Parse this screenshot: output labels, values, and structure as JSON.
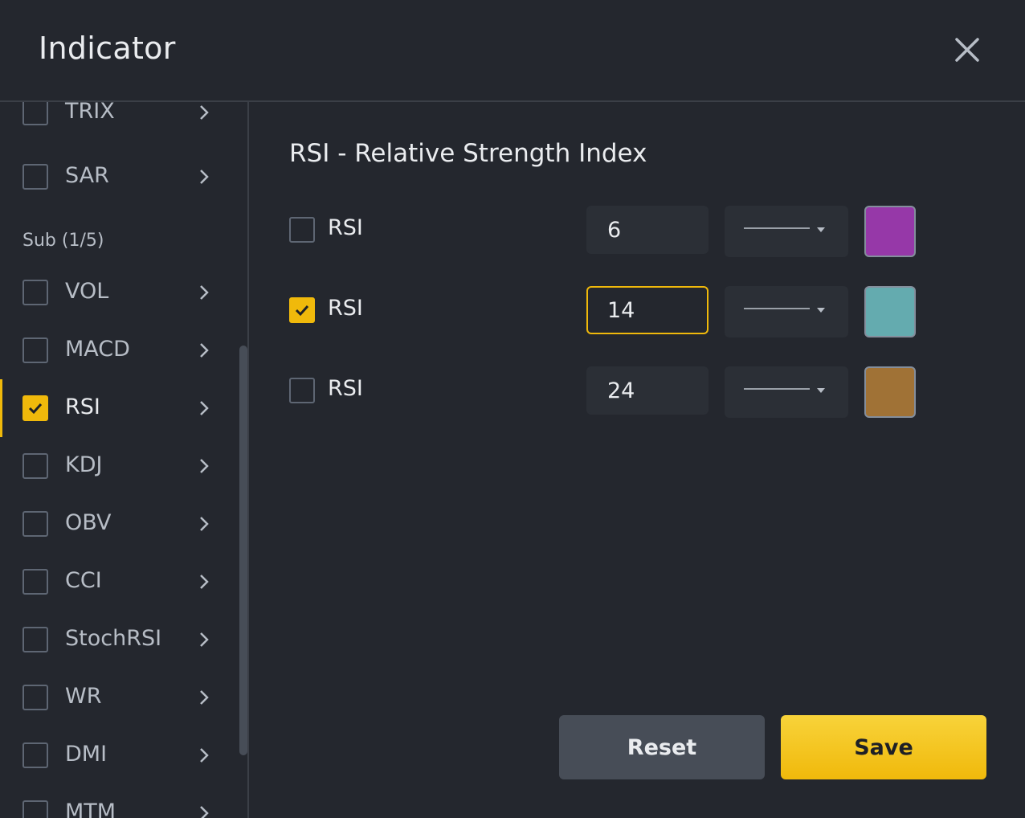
{
  "header": {
    "title": "Indicator"
  },
  "sidebar": {
    "top_items": [
      {
        "label": "TRIX",
        "checked": false
      },
      {
        "label": "SAR",
        "checked": false
      }
    ],
    "group_label": "Sub (1/5)",
    "sub_items": [
      {
        "label": "VOL",
        "checked": false
      },
      {
        "label": "MACD",
        "checked": false
      },
      {
        "label": "RSI",
        "checked": true,
        "active": true
      },
      {
        "label": "KDJ",
        "checked": false
      },
      {
        "label": "OBV",
        "checked": false
      },
      {
        "label": "CCI",
        "checked": false
      },
      {
        "label": "StochRSI",
        "checked": false
      },
      {
        "label": "WR",
        "checked": false
      },
      {
        "label": "DMI",
        "checked": false
      },
      {
        "label": "MTM",
        "checked": false
      }
    ]
  },
  "main": {
    "title": "RSI - Relative Strength Index",
    "rows": [
      {
        "label": "RSI",
        "checked": false,
        "period": "6",
        "color": "#9638a8",
        "focused": false
      },
      {
        "label": "RSI",
        "checked": true,
        "period": "14",
        "color": "#64abaf",
        "focused": true
      },
      {
        "label": "RSI",
        "checked": false,
        "period": "24",
        "color": "#a07236",
        "focused": false
      }
    ]
  },
  "buttons": {
    "reset": "Reset",
    "save": "Save"
  },
  "theme": {
    "accent": "#f0b90b",
    "background": "#24272e",
    "panel": "#2b2f36"
  }
}
